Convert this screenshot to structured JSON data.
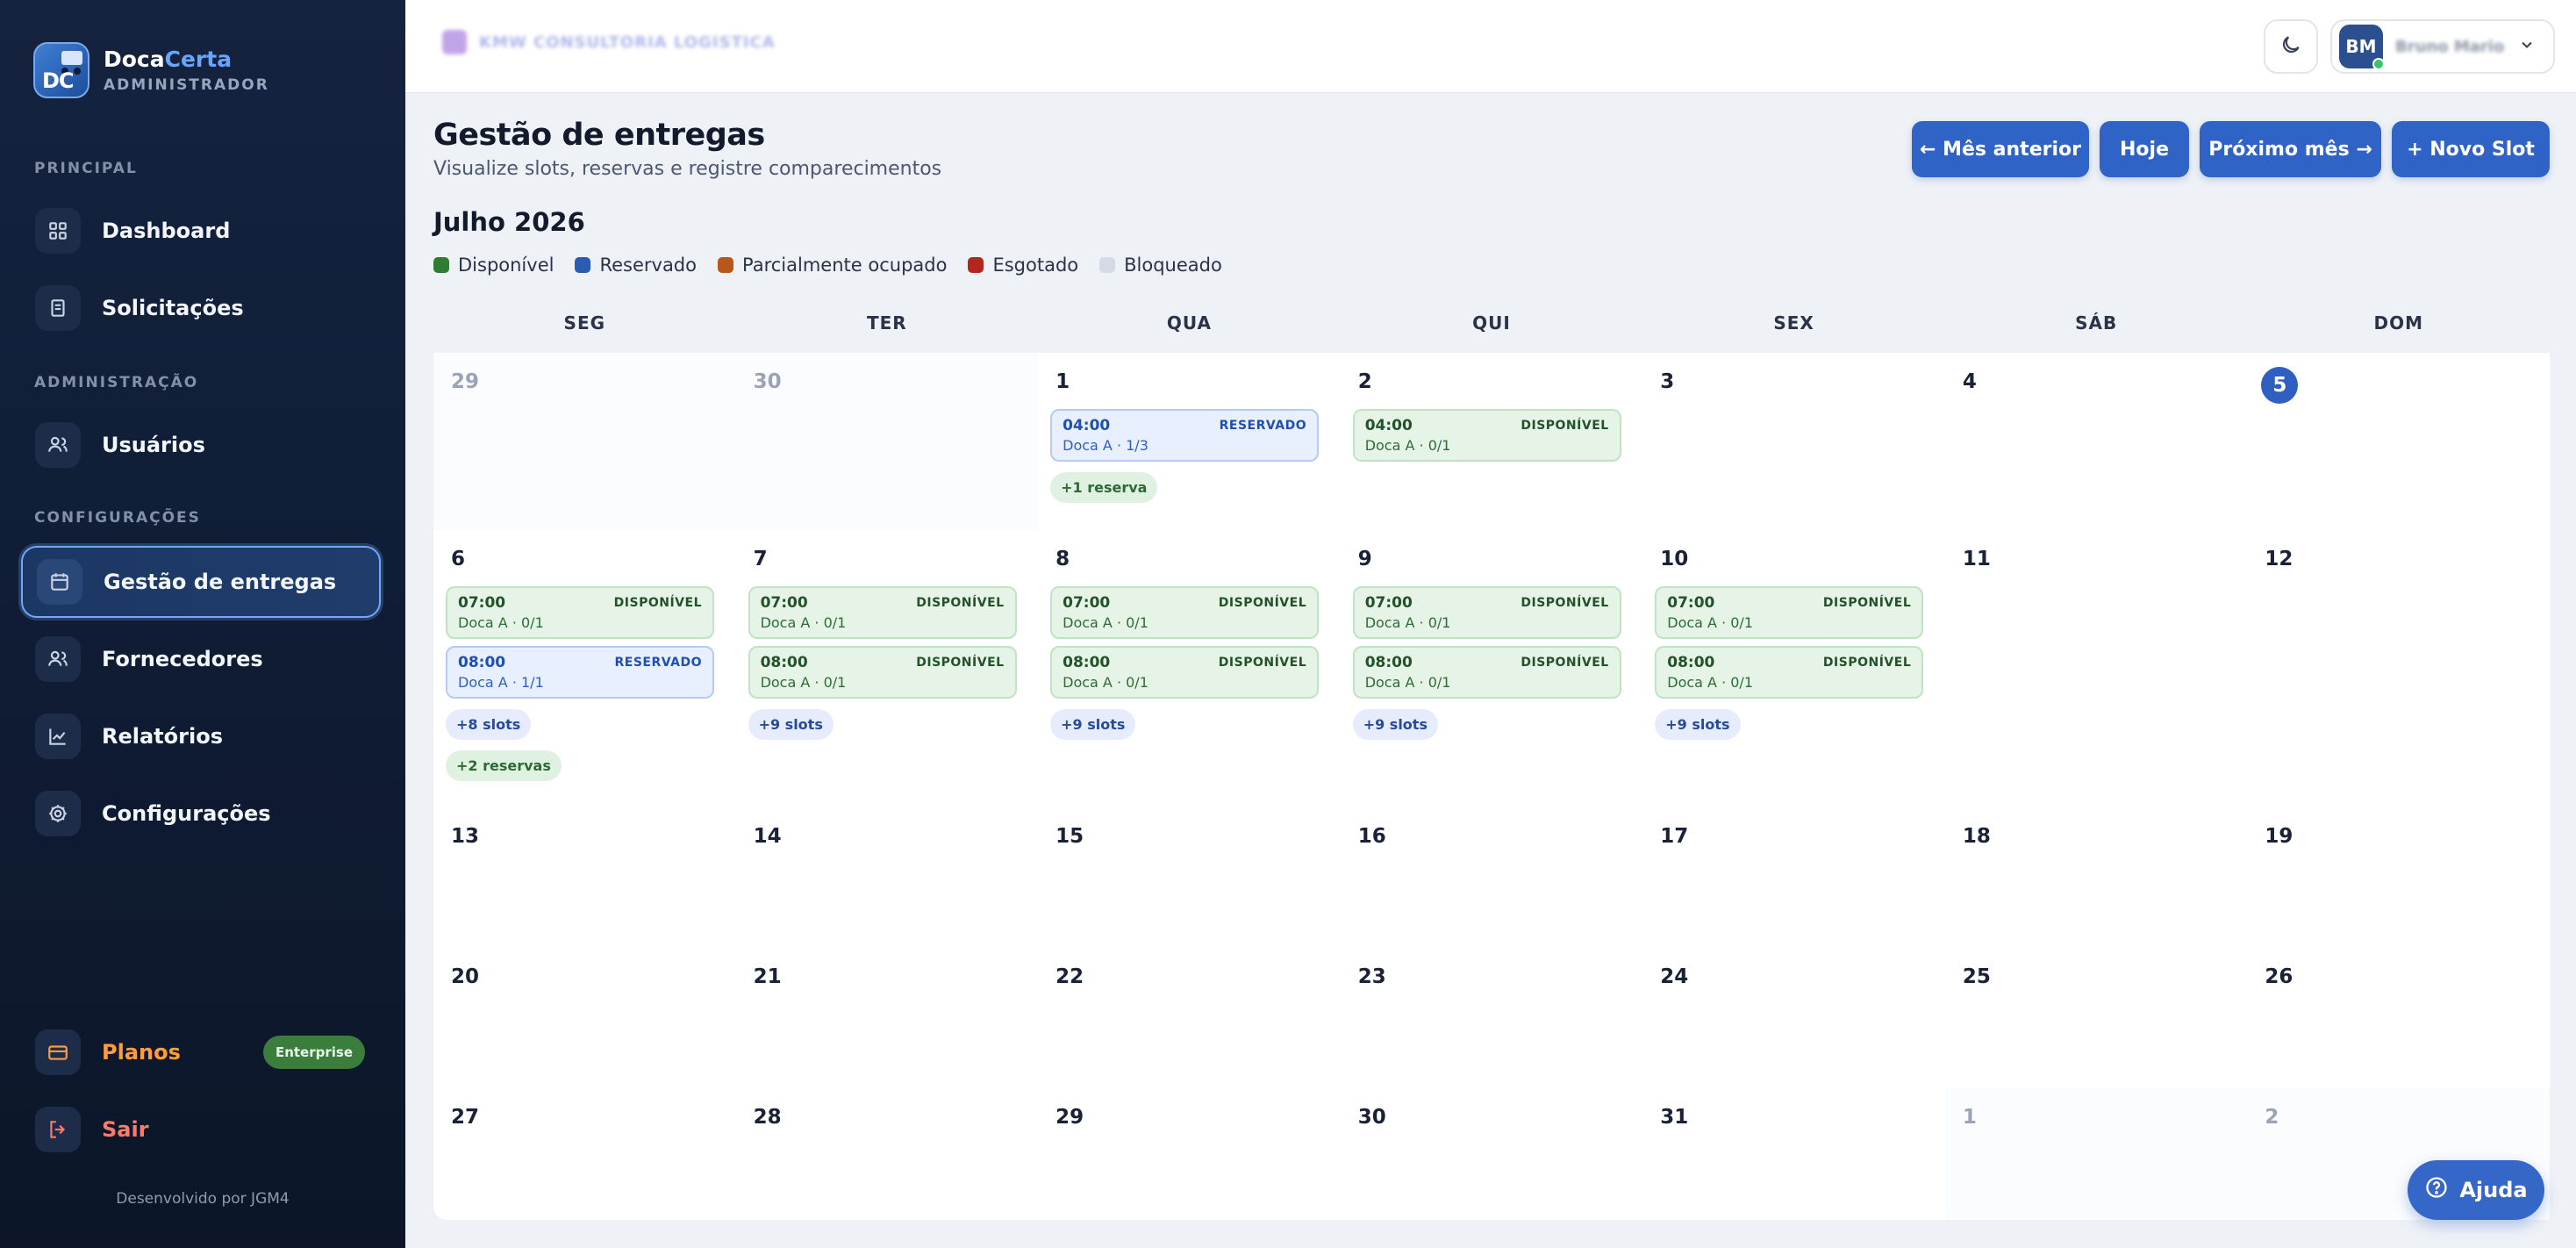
{
  "brand": {
    "name_part1": "Doca",
    "name_part2": "Certa",
    "role": "ADMINISTRADOR",
    "logo_text": "DC"
  },
  "sidebar": {
    "sections": {
      "principal": "PRINCIPAL",
      "administracao": "ADMINISTRAÇÃO",
      "configuracoes": "CONFIGURAÇÕES"
    },
    "items": {
      "dashboard": "Dashboard",
      "solicitacoes": "Solicitações",
      "usuarios": "Usuários",
      "gestao": "Gestão de entregas",
      "fornecedores": "Fornecedores",
      "relatorios": "Relatórios",
      "configuracoes": "Configurações"
    },
    "planos": "Planos",
    "planos_badge": "Enterprise",
    "sair": "Sair",
    "footer": "Desenvolvido por JGM4"
  },
  "topbar": {
    "company": "KMW CONSULTORIA LOGISTICA",
    "user_initials": "BM",
    "user_name": "Bruno Mario"
  },
  "header": {
    "title": "Gestão de entregas",
    "subtitle": "Visualize slots, reservas e registre comparecimentos",
    "btn_prev": "← Mês anterior",
    "btn_today": "Hoje",
    "btn_next": "Próximo mês →",
    "btn_new": "+  Novo Slot"
  },
  "calendar": {
    "month": "Julho 2026",
    "legend": [
      {
        "label": "Disponível",
        "color": "#2f7d32"
      },
      {
        "label": "Reservado",
        "color": "#2b5bb5"
      },
      {
        "label": "Parcialmente ocupado",
        "color": "#b8571a"
      },
      {
        "label": "Esgotado",
        "color": "#b3261e"
      },
      {
        "label": "Bloqueado",
        "color": "#d5dbe5"
      }
    ],
    "weekdays": [
      "SEG",
      "TER",
      "QUA",
      "QUI",
      "SEX",
      "SÁB",
      "DOM"
    ],
    "weeks": [
      {
        "days": [
          {
            "n": "29",
            "other": true,
            "slots": [],
            "pills": []
          },
          {
            "n": "30",
            "other": true,
            "slots": [],
            "pills": []
          },
          {
            "n": "1",
            "slots": [
              {
                "time": "04:00",
                "status": "RESERVADO",
                "doc": "Doca A · 1/3",
                "kind": "res"
              }
            ],
            "pills": [
              {
                "text": "+1 reserva",
                "kind": "resv"
              }
            ]
          },
          {
            "n": "2",
            "slots": [
              {
                "time": "04:00",
                "status": "DISPONÍVEL",
                "doc": "Doca A · 0/1",
                "kind": "disp"
              }
            ],
            "pills": []
          },
          {
            "n": "3",
            "slots": [],
            "pills": []
          },
          {
            "n": "4",
            "slots": [],
            "pills": []
          },
          {
            "n": "5",
            "today": true,
            "slots": [],
            "pills": []
          }
        ]
      },
      {
        "days": [
          {
            "n": "6",
            "slots": [
              {
                "time": "07:00",
                "status": "DISPONÍVEL",
                "doc": "Doca A · 0/1",
                "kind": "disp"
              },
              {
                "time": "08:00",
                "status": "RESERVADO",
                "doc": "Doca A · 1/1",
                "kind": "res"
              }
            ],
            "pills": [
              {
                "text": "+8 slots",
                "kind": "more"
              },
              {
                "text": "+2 reservas",
                "kind": "resv"
              }
            ]
          },
          {
            "n": "7",
            "slots": [
              {
                "time": "07:00",
                "status": "DISPONÍVEL",
                "doc": "Doca A · 0/1",
                "kind": "disp"
              },
              {
                "time": "08:00",
                "status": "DISPONÍVEL",
                "doc": "Doca A · 0/1",
                "kind": "disp"
              }
            ],
            "pills": [
              {
                "text": "+9 slots",
                "kind": "more"
              }
            ]
          },
          {
            "n": "8",
            "slots": [
              {
                "time": "07:00",
                "status": "DISPONÍVEL",
                "doc": "Doca A · 0/1",
                "kind": "disp"
              },
              {
                "time": "08:00",
                "status": "DISPONÍVEL",
                "doc": "Doca A · 0/1",
                "kind": "disp"
              }
            ],
            "pills": [
              {
                "text": "+9 slots",
                "kind": "more"
              }
            ]
          },
          {
            "n": "9",
            "slots": [
              {
                "time": "07:00",
                "status": "DISPONÍVEL",
                "doc": "Doca A · 0/1",
                "kind": "disp"
              },
              {
                "time": "08:00",
                "status": "DISPONÍVEL",
                "doc": "Doca A · 0/1",
                "kind": "disp"
              }
            ],
            "pills": [
              {
                "text": "+9 slots",
                "kind": "more"
              }
            ]
          },
          {
            "n": "10",
            "slots": [
              {
                "time": "07:00",
                "status": "DISPONÍVEL",
                "doc": "Doca A · 0/1",
                "kind": "disp"
              },
              {
                "time": "08:00",
                "status": "DISPONÍVEL",
                "doc": "Doca A · 0/1",
                "kind": "disp"
              }
            ],
            "pills": [
              {
                "text": "+9 slots",
                "kind": "more"
              }
            ]
          },
          {
            "n": "11",
            "slots": [],
            "pills": []
          },
          {
            "n": "12",
            "slots": [],
            "pills": []
          }
        ]
      },
      {
        "days": [
          {
            "n": "13",
            "slots": [],
            "pills": []
          },
          {
            "n": "14",
            "slots": [],
            "pills": []
          },
          {
            "n": "15",
            "slots": [],
            "pills": []
          },
          {
            "n": "16",
            "slots": [],
            "pills": []
          },
          {
            "n": "17",
            "slots": [],
            "pills": []
          },
          {
            "n": "18",
            "slots": [],
            "pills": []
          },
          {
            "n": "19",
            "slots": [],
            "pills": []
          }
        ]
      },
      {
        "days": [
          {
            "n": "20",
            "slots": [],
            "pills": []
          },
          {
            "n": "21",
            "slots": [],
            "pills": []
          },
          {
            "n": "22",
            "slots": [],
            "pills": []
          },
          {
            "n": "23",
            "slots": [],
            "pills": []
          },
          {
            "n": "24",
            "slots": [],
            "pills": []
          },
          {
            "n": "25",
            "slots": [],
            "pills": []
          },
          {
            "n": "26",
            "slots": [],
            "pills": []
          }
        ]
      },
      {
        "days": [
          {
            "n": "27",
            "slots": [],
            "pills": []
          },
          {
            "n": "28",
            "slots": [],
            "pills": []
          },
          {
            "n": "29",
            "slots": [],
            "pills": []
          },
          {
            "n": "30",
            "slots": [],
            "pills": []
          },
          {
            "n": "31",
            "slots": [],
            "pills": []
          },
          {
            "n": "1",
            "other": true,
            "slots": [],
            "pills": []
          },
          {
            "n": "2",
            "other": true,
            "slots": [],
            "pills": []
          }
        ]
      }
    ]
  },
  "help": {
    "label": "Ajuda"
  }
}
